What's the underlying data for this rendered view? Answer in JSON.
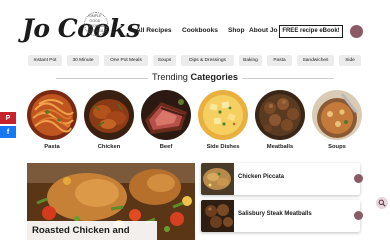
{
  "site": {
    "logo_text": "Jo Cooks",
    "seal_text": "SIMPLE · GOOD · COOKING",
    "seal_est": "EST. 2011"
  },
  "nav": {
    "items": [
      {
        "label": "All Recipes"
      },
      {
        "label": "Cookbooks"
      },
      {
        "label": "Shop"
      },
      {
        "label": "About Jo"
      }
    ],
    "ebook_button": "FREE recipe eBook!"
  },
  "category_pills": [
    {
      "label": "Instant Pot"
    },
    {
      "label": "30 Minute"
    },
    {
      "label": "One Pot Meals"
    },
    {
      "label": "Soups"
    },
    {
      "label": "Dips & Dressings"
    },
    {
      "label": "Baking"
    },
    {
      "label": "Pasta"
    },
    {
      "label": "Sandwiches"
    },
    {
      "label": "Side"
    }
  ],
  "trending": {
    "prefix": "Trending ",
    "emphasis": "Categories",
    "categories": [
      {
        "label": "Pasta"
      },
      {
        "label": "Chicken"
      },
      {
        "label": "Beef"
      },
      {
        "label": "Side Dishes"
      },
      {
        "label": "Meatballs"
      },
      {
        "label": "Soups"
      }
    ]
  },
  "social": {
    "pinterest_glyph": "P",
    "facebook_glyph": "f"
  },
  "featured": {
    "title": "Roasted Chicken and"
  },
  "side_list": [
    {
      "title": "Chicken Piccata"
    },
    {
      "title": "Salisbury Steak Meatballs"
    }
  ],
  "colors": {
    "accent": "#8a5a66",
    "pill_bg": "#ececec",
    "pinterest": "#c8232c",
    "facebook": "#1877f2"
  },
  "icons": [
    "pinterest-icon",
    "facebook-icon",
    "search-icon",
    "user-avatar"
  ]
}
